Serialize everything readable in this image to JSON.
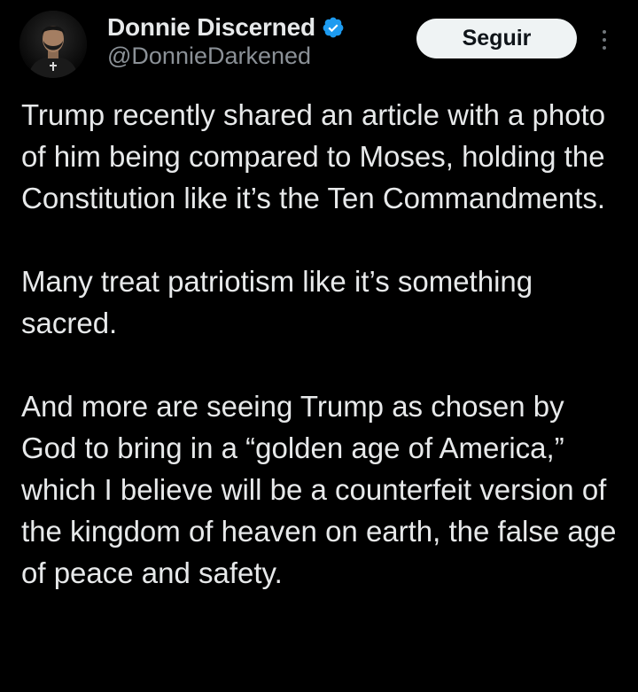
{
  "post": {
    "author": {
      "display_name": "Donnie Discerned",
      "handle": "@DonnieDarkened",
      "verified": true,
      "verified_color": "#1d9bf0"
    },
    "follow_label": "Seguir",
    "more_icon": "more-vertical-icon",
    "paragraphs": [
      "Trump recently shared an article with a photo of him being compared to Moses, holding the Constitution like it’s the Ten Commandments.",
      "Many treat patriotism like it’s something sacred.",
      "And more are seeing Trump as chosen by God to bring in a “golden age of America,” which I believe will be a counterfeit version of the kingdom of heaven on earth, the false age of peace and safety."
    ]
  },
  "colors": {
    "background": "#000000",
    "text_primary": "#e7e9ea",
    "text_secondary": "#8b9197",
    "button_bg": "#eff3f4",
    "button_text": "#0f1419"
  }
}
